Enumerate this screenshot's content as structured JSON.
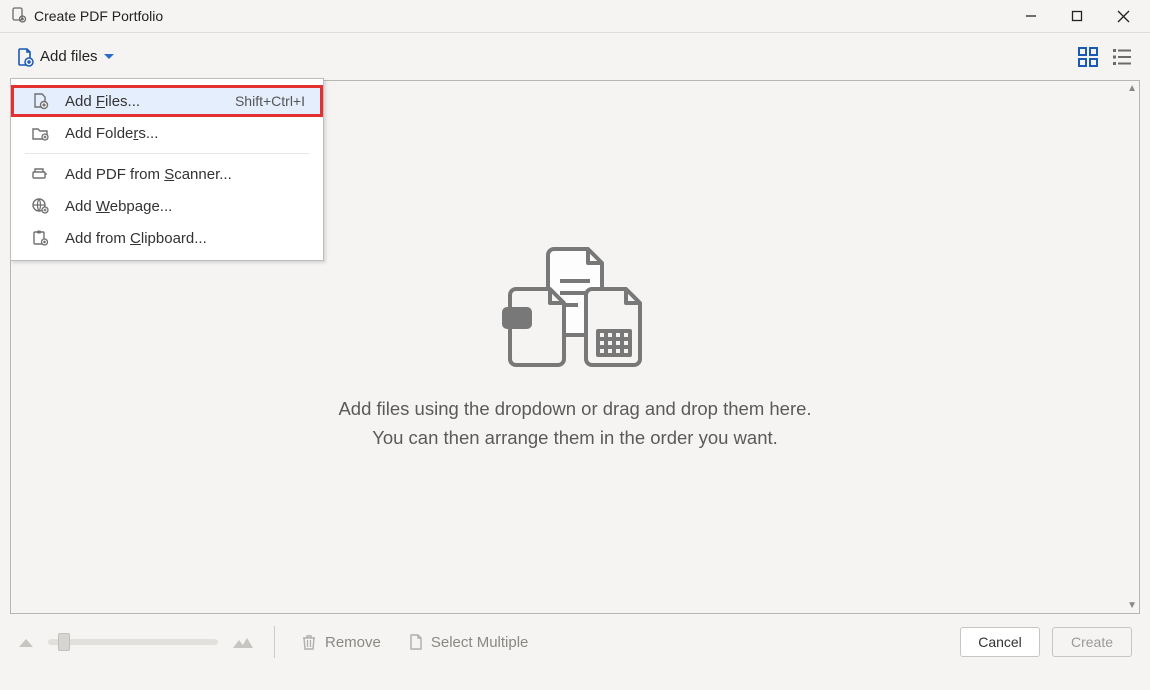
{
  "window": {
    "title": "Create PDF Portfolio"
  },
  "toolbar": {
    "add_files_label": "Add files"
  },
  "dropdown": {
    "items": [
      {
        "label_pre": "Add ",
        "mn": "F",
        "label_post": "iles...",
        "shortcut": "Shift+Ctrl+I"
      },
      {
        "label_pre": "Add Folde",
        "mn": "r",
        "label_post": "s...",
        "shortcut": ""
      },
      {
        "label_pre": "Add PDF from ",
        "mn": "S",
        "label_post": "canner...",
        "shortcut": ""
      },
      {
        "label_pre": "Add ",
        "mn": "W",
        "label_post": "ebpage...",
        "shortcut": ""
      },
      {
        "label_pre": "Add from ",
        "mn": "C",
        "label_post": "lipboard...",
        "shortcut": ""
      }
    ]
  },
  "placeholder": {
    "line1": "Add files using the dropdown or drag and drop them here.",
    "line2": "You can then arrange them in the order you want."
  },
  "footer": {
    "remove": "Remove",
    "select_multiple": "Select Multiple",
    "cancel": "Cancel",
    "create": "Create"
  }
}
